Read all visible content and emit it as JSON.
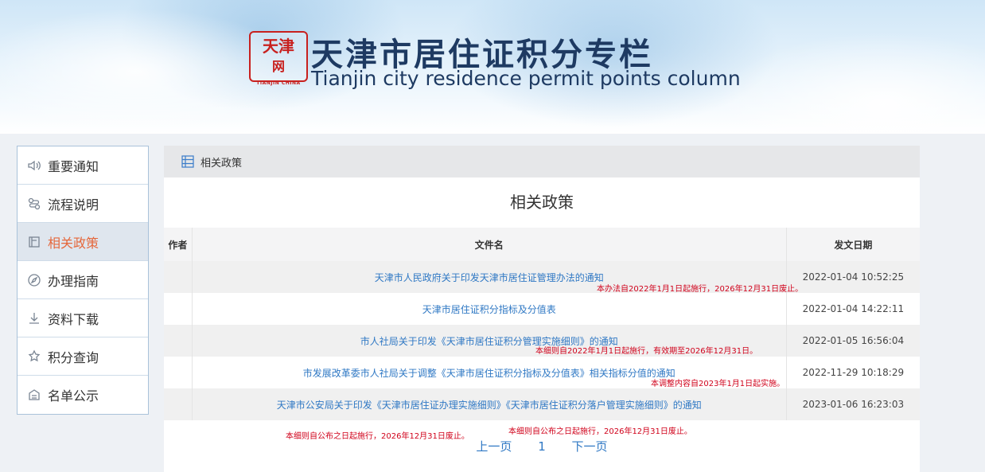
{
  "banner": {
    "title": "天津市居住证积分专栏",
    "subtitle": "Tianjin city residence permit points column",
    "seal_text": "天津",
    "seal_caption": "TIANJIN CHINA"
  },
  "sidebar": {
    "items": [
      {
        "label": "重要通知",
        "icon": "speaker-icon"
      },
      {
        "label": "流程说明",
        "icon": "flow-icon"
      },
      {
        "label": "相关政策",
        "icon": "policy-icon",
        "active": true
      },
      {
        "label": "办理指南",
        "icon": "compass-icon"
      },
      {
        "label": "资料下载",
        "icon": "download-icon"
      },
      {
        "label": "积分查询",
        "icon": "points-icon"
      },
      {
        "label": "名单公示",
        "icon": "list-icon"
      }
    ]
  },
  "breadcrumb": {
    "label": "相关政策",
    "icon": "list-icon"
  },
  "page_title": "相关政策",
  "table": {
    "headers": [
      "作者",
      "文件名",
      "发文日期"
    ],
    "rows": [
      {
        "author": "",
        "name": "天津市人民政府关于印发天津市居住证管理办法的通知",
        "date": "2022-01-04 10:52:25"
      },
      {
        "author": "",
        "name": "天津市居住证积分指标及分值表",
        "date": "2022-01-04 14:22:11"
      },
      {
        "author": "",
        "name": "市人社局关于印发《天津市居住证积分管理实施细则》的通知",
        "date": "2022-01-05 16:56:04"
      },
      {
        "author": "",
        "name": "市发展改革委市人社局关于调整《天津市居住证积分指标及分值表》相关指标分值的通知",
        "date": "2022-11-29 10:18:29"
      },
      {
        "author": "",
        "name": "天津市公安局关于印发《天津市居住证办理实施细则》《天津市居住证积分落户管理实施细则》的通知",
        "date": "2023-01-06 16:23:03"
      }
    ]
  },
  "notes": [
    "本办法自2022年1月1日起施行，2026年12月31日废止。",
    "本细则自2022年1月1日起施行，有效期至2026年12月31日。",
    "本调整内容自2023年1月1日起实施。",
    "本细则自公布之日起施行，2026年12月31日废止。",
    "本细则自公布之日起施行，2026年12月31日废止。"
  ],
  "pager": {
    "prev": "上一页",
    "current": "1",
    "next": "下一页"
  },
  "colors": {
    "accent": "#2f78c4",
    "active": "#e5673b",
    "note": "#d0021b"
  }
}
